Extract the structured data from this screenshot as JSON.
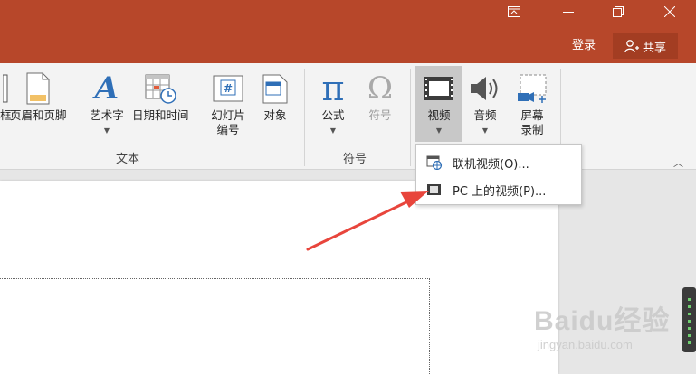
{
  "titlebar": {
    "login_label": "登录",
    "share_label": "共享",
    "window_buttons": [
      "restore-ribbon-icon",
      "minimize-icon",
      "maximize-icon",
      "close-icon"
    ]
  },
  "ribbon": {
    "groups": {
      "text": {
        "label": "文本"
      },
      "symbols": {
        "label": "符号"
      }
    },
    "buttons": {
      "textbox_partial": "框",
      "header_footer": "页眉和页脚",
      "wordart": "艺术字",
      "datetime": "日期和时间",
      "slide_number_line1": "幻灯片",
      "slide_number_line2": "编号",
      "object": "对象",
      "equation": "公式",
      "symbol": "符号",
      "video": "视频",
      "audio": "音频",
      "screen_rec_line1": "屏幕",
      "screen_rec_line2": "录制"
    },
    "icons": {
      "equation": "π",
      "symbol": "Ω",
      "wordart": "A"
    }
  },
  "dropdown": {
    "items": [
      {
        "label": "联机视频(O)...",
        "icon": "online-video-icon"
      },
      {
        "label": "PC 上的视频(P)...",
        "icon": "pc-video-icon"
      }
    ]
  },
  "watermark": {
    "big": "Baidu经验",
    "small": "jingyan.baidu.com"
  },
  "colors": {
    "title_bar": "#b7472a",
    "annotation_arrow": "#e8453c"
  }
}
